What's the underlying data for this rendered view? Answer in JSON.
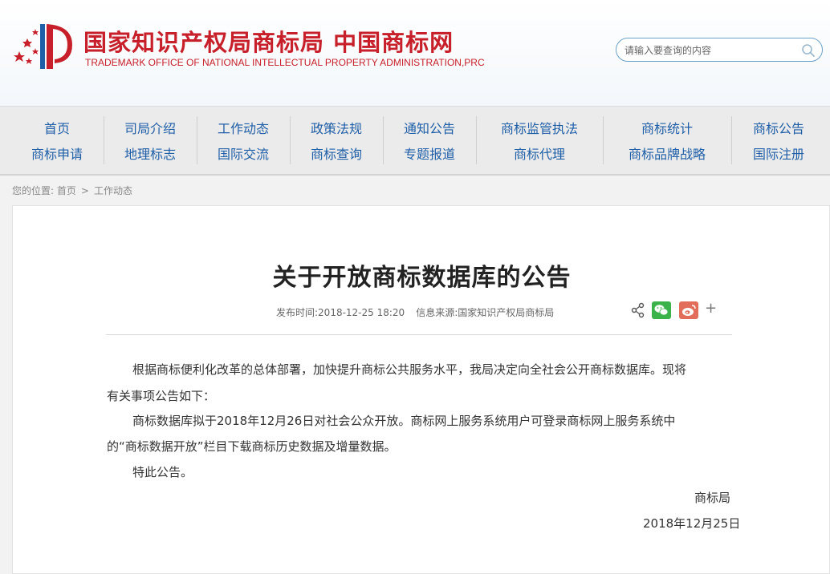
{
  "header": {
    "title_cn": "国家知识产权局商标局 中国商标网",
    "title_en": "TRADEMARK OFFICE OF NATIONAL INTELLECTUAL PROPERTY ADMINISTRATION,PRC",
    "search_placeholder": "请输入要查询的内容"
  },
  "nav": {
    "columns": [
      {
        "top": "首页",
        "bottom": "商标申请"
      },
      {
        "top": "司局介绍",
        "bottom": "地理标志"
      },
      {
        "top": "工作动态",
        "bottom": "国际交流"
      },
      {
        "top": "政策法规",
        "bottom": "商标查询"
      },
      {
        "top": "通知公告",
        "bottom": "专题报道"
      },
      {
        "top": "商标监管执法",
        "bottom": "商标代理"
      },
      {
        "top": "商标统计",
        "bottom": "商标品牌战略"
      },
      {
        "top": "商标公告",
        "bottom": "国际注册"
      }
    ]
  },
  "breadcrumb": {
    "label": "您的位置:",
    "items": [
      "首页",
      "工作动态"
    ],
    "separator": ">"
  },
  "article": {
    "title": "关于开放商标数据库的公告",
    "publish_label": "发布时间:",
    "publish_time": "2018-12-25 18:20",
    "source_label": "信息来源:",
    "source": "国家知识产权局商标局",
    "paragraphs": [
      "根据商标便利化改革的总体部署，加快提升商标公共服务水平，我局决定向全社会公开商标数据库。现将",
      "有关事项公告如下：",
      "商标数据库拟于2018年12月26日对社会公众开放。商标网上服务系统用户可登录商标网上服务系统中",
      "的“商标数据开放”栏目下载商标历史数据及增量数据。",
      "特此公告。"
    ],
    "signature": "商标局",
    "date": "2018年12月25日"
  },
  "share": {
    "icons": [
      "share-icon",
      "wechat-icon",
      "weibo-icon",
      "plus-icon"
    ],
    "plus_label": "+"
  },
  "colors": {
    "brand_red": "#c8202a",
    "nav_blue": "#1f5fa8",
    "wechat_green": "#3bb34a",
    "weibo_red": "#e26d5a"
  }
}
